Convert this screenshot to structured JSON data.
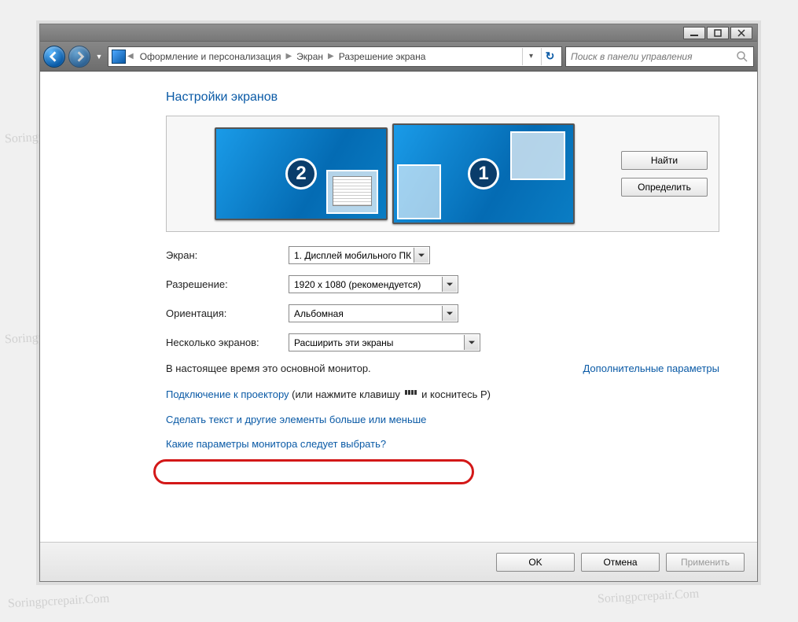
{
  "breadcrumb": {
    "items": [
      "Оформление и персонализация",
      "Экран",
      "Разрешение экрана"
    ]
  },
  "search": {
    "placeholder": "Поиск в панели управления"
  },
  "heading": "Настройки экранов",
  "monitorPanel": {
    "findButton": "Найти",
    "identifyButton": "Определить",
    "monitor1Num": "1",
    "monitor2Num": "2"
  },
  "form": {
    "screenLabel": "Экран:",
    "screenValue": "1. Дисплей мобильного ПК",
    "resolutionLabel": "Разрешение:",
    "resolutionValue": "1920 x 1080 (рекомендуется)",
    "orientationLabel": "Ориентация:",
    "orientationValue": "Альбомная",
    "multiLabel": "Несколько экранов:",
    "multiValue": "Расширить эти экраны"
  },
  "statusText": "В настоящее время это основной монитор.",
  "advancedLink": "Дополнительные параметры",
  "links": {
    "projectorLink": "Подключение к проектору",
    "projectorRest": "(или нажмите клавишу",
    "projectorTail": "и коснитесь P)",
    "scaleLink": "Сделать текст и другие элементы больше или меньше",
    "helpLink": "Какие параметры монитора следует выбрать?"
  },
  "footer": {
    "ok": "OK",
    "cancel": "Отмена",
    "apply": "Применить"
  },
  "watermark": "Soringpcrepair.Com"
}
